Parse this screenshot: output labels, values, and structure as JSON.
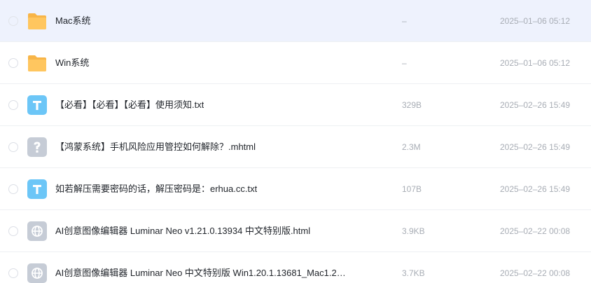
{
  "files": [
    {
      "name": "Mac系统",
      "size": "–",
      "date": "2025–01–06 05:12",
      "icon": "folder-icon",
      "selected": true
    },
    {
      "name": "Win系统",
      "size": "–",
      "date": "2025–01–06 05:12",
      "icon": "folder-icon",
      "selected": false
    },
    {
      "name": "【必看】【必看】【必看】使用须知.txt",
      "size": "329B",
      "date": "2025–02–26 15:49",
      "icon": "text-file-icon",
      "selected": false
    },
    {
      "name": "【鸿蒙系统】手机风险应用管控如何解除？.mhtml",
      "size": "2.3M",
      "date": "2025–02–26 15:49",
      "icon": "unknown-file-icon",
      "selected": false
    },
    {
      "name": "如若解压需要密码的话，解压密码是：erhua.cc.txt",
      "size": "107B",
      "date": "2025–02–26 15:49",
      "icon": "text-file-icon",
      "selected": false
    },
    {
      "name": "AI创意图像编辑器 Luminar Neo v1.21.0.13934 中文特别版.html",
      "size": "3.9KB",
      "date": "2025–02–22 00:08",
      "icon": "web-file-icon",
      "selected": false
    },
    {
      "name": "AI创意图像编辑器 Luminar Neo 中文特别版 Win1.20.1.13681_Mac1.2…",
      "size": "3.7KB",
      "date": "2025–02–22 00:08",
      "icon": "web-file-icon",
      "selected": false
    }
  ],
  "colors": {
    "selected_row_bg": "#eef2fd",
    "folder": "#ffc65f",
    "text_file": "#6cc6f7",
    "unknown_file": "#c6ccd6",
    "web_file": "#c6ccd6"
  }
}
